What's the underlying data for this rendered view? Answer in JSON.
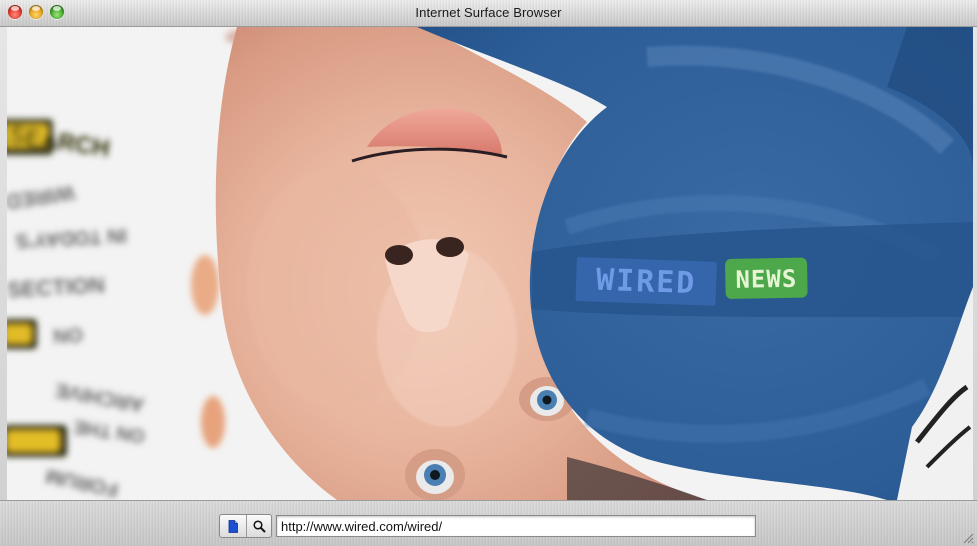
{
  "window": {
    "title": "Internet Surface Browser"
  },
  "toolbar": {
    "page_button_icon": "document-icon",
    "search_button_icon": "magnifier-icon",
    "url_value": "http://www.wired.com/wired/"
  },
  "content": {
    "logo_text": "WIRED",
    "logo_badge_text": "NEWS",
    "menu_items": [
      "SEARCH",
      "WIRED",
      "IN TODAY'S",
      "SECTION",
      "ON",
      "ARCHIVE",
      "ON THE",
      "FORUM"
    ]
  },
  "colors": {
    "accent_blue": "#2f5f99",
    "badge_green": "#4ca84a",
    "logo_blue": "#4f7fd1"
  }
}
